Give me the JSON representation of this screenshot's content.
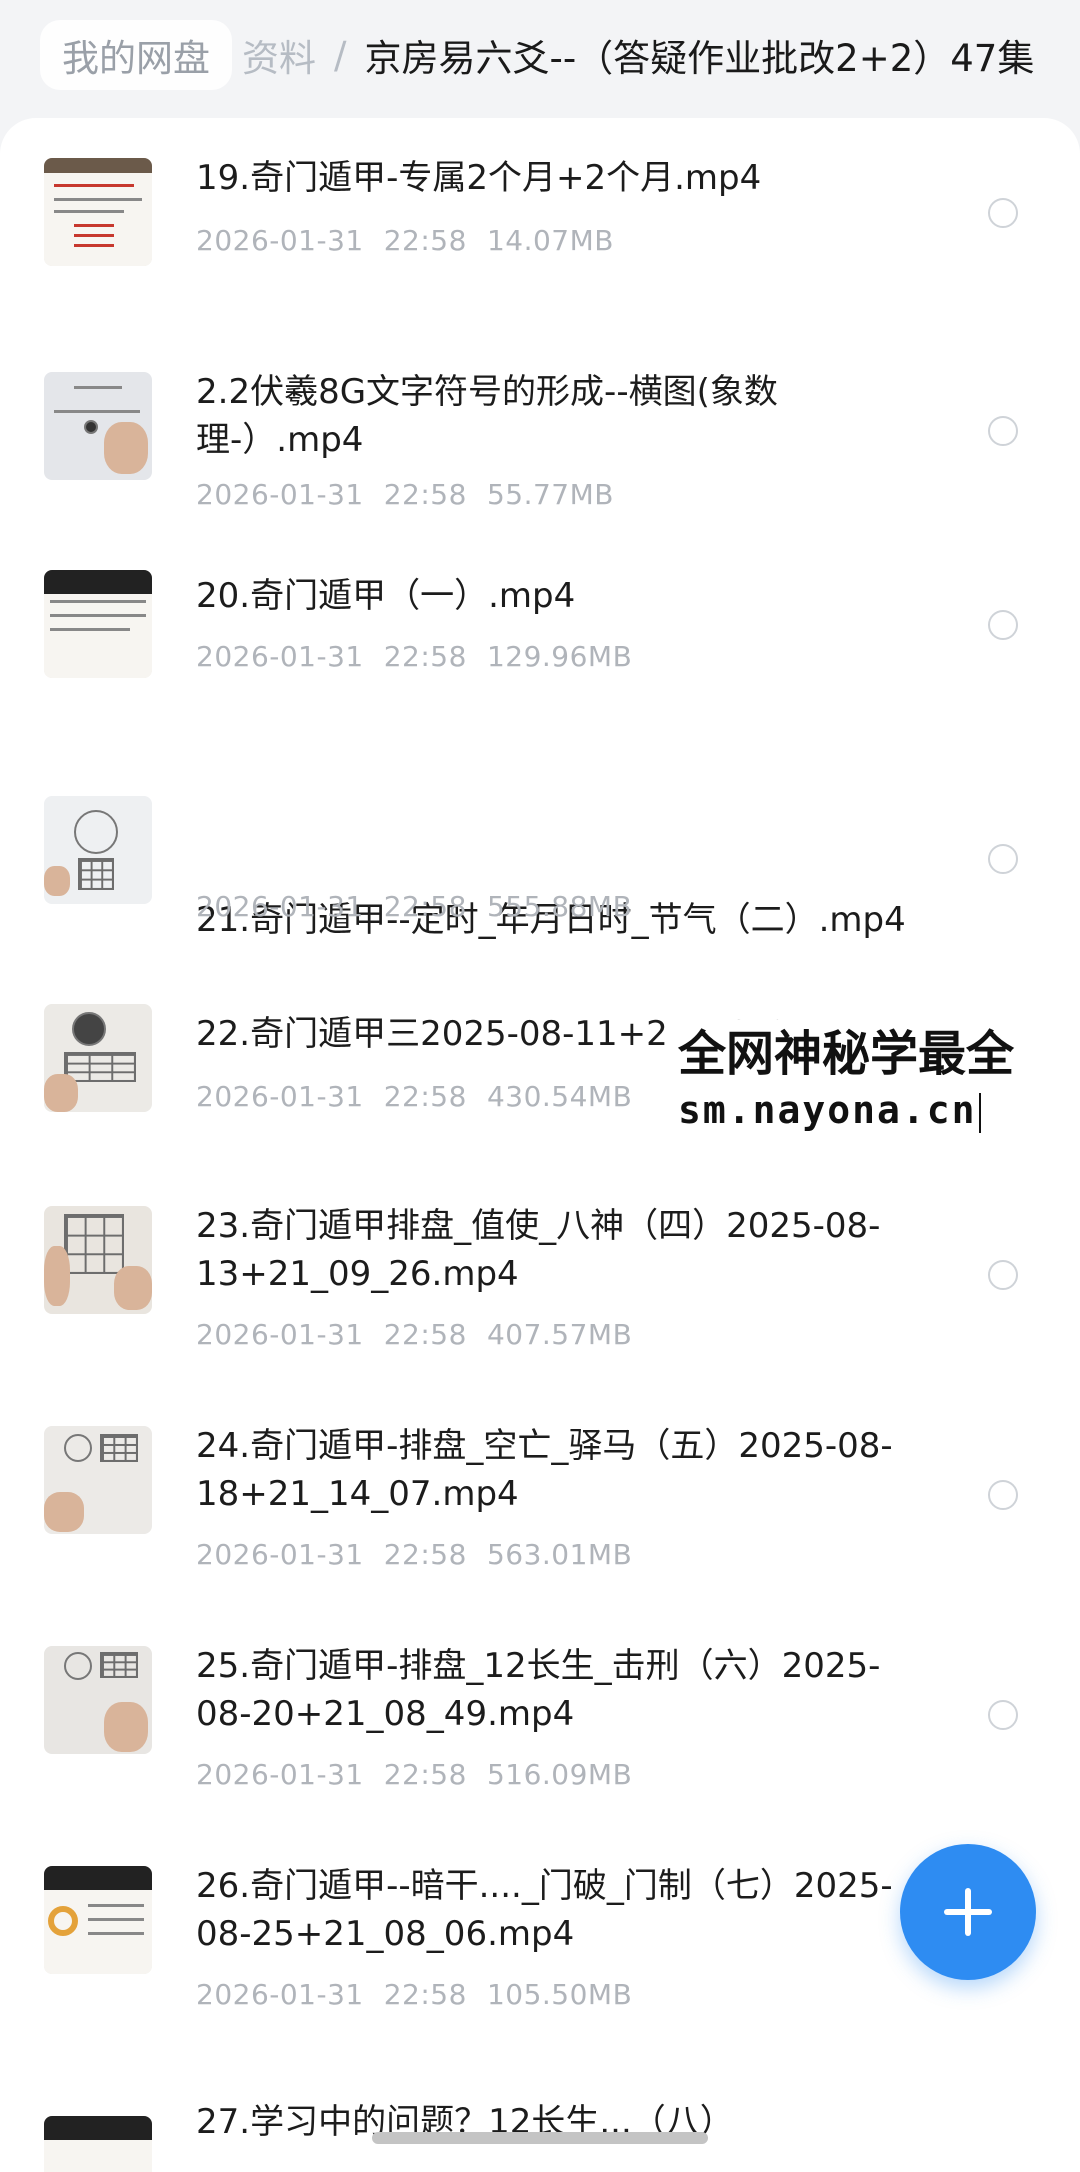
{
  "breadcrumb": {
    "root": "我的网盘",
    "parent": "资料",
    "separator": "/",
    "current": "京房易六爻--（答疑作业批改2+2）47集"
  },
  "files": [
    {
      "name": "19.奇门遁甲-专属2个月+2个月.mp4",
      "date": "2026-01-31",
      "time": "22:58",
      "size": "14.07MB",
      "thumb_icon": "slide-thumbnail-icon"
    },
    {
      "name": "2.2伏羲8G文字符号的形成--横图(象数理-）.mp4",
      "date": "2026-01-31",
      "time": "22:58",
      "size": "55.77MB",
      "thumb_icon": "whiteboard-thumbnail-icon"
    },
    {
      "name": "20.奇门遁甲（一）.mp4",
      "date": "2026-01-31",
      "time": "22:58",
      "size": "129.96MB",
      "thumb_icon": "slide-thumbnail-icon"
    },
    {
      "name": "21.奇门遁甲--定时_年月日时_节气（二）.mp4",
      "date": "2026-01-31",
      "time": "22:58",
      "size": "555.88MB",
      "thumb_icon": "paper-grid-thumbnail-icon"
    },
    {
      "name": "22.奇门遁甲三2025-08-11+21_18_01.mp4",
      "date": "2026-01-31",
      "time": "22:58",
      "size": "430.54MB",
      "thumb_icon": "paper-grid-thumbnail-icon"
    },
    {
      "name": "23.奇门遁甲排盘_值使_八神（四）2025-08-13+21_09_26.mp4",
      "date": "2026-01-31",
      "time": "22:58",
      "size": "407.57MB",
      "thumb_icon": "paper-grid-thumbnail-icon"
    },
    {
      "name": "24.奇门遁甲-排盘_空亡_驿马（五）2025-08-18+21_14_07.mp4",
      "date": "2026-01-31",
      "time": "22:58",
      "size": "563.01MB",
      "thumb_icon": "paper-grid-thumbnail-icon"
    },
    {
      "name": "25.奇门遁甲-排盘_12长生_击刑（六）2025-08-20+21_08_49.mp4",
      "date": "2026-01-31",
      "time": "22:58",
      "size": "516.09MB",
      "thumb_icon": "paper-grid-thumbnail-icon"
    },
    {
      "name": "26.奇门遁甲--暗干...._门破_门制（七）2025-08-25+21_08_06.mp4",
      "date": "2026-01-31",
      "time": "22:58",
      "size": "105.50MB",
      "thumb_icon": "slide-thumbnail-icon"
    },
    {
      "name": "27.学习中的问题？12长生...（八）",
      "date": "",
      "time": "",
      "size": "",
      "thumb_icon": "slide-thumbnail-icon"
    }
  ],
  "watermark": {
    "title": "全网神秘学最全",
    "url": "sm.nayona.cn"
  },
  "fab": {
    "icon": "plus-icon"
  },
  "colors": {
    "accent": "#2e8cf2",
    "meta_text": "#b0b4ba",
    "background": "#f3f4f6"
  }
}
